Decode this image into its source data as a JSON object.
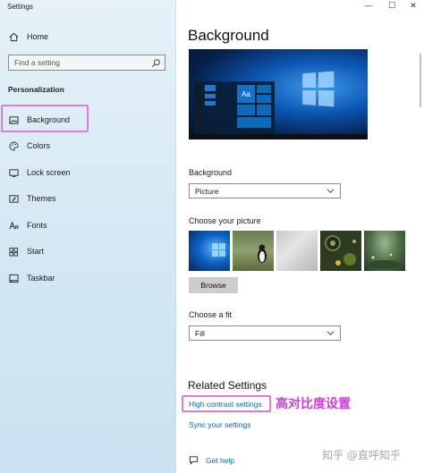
{
  "window": {
    "title": "Settings",
    "controls": [
      "—",
      "☐",
      "✕"
    ]
  },
  "sidebar": {
    "home_label": "Home",
    "search_placeholder": "Find a setting",
    "section_label": "Personalization",
    "items": [
      {
        "label": "Background",
        "icon": "picture-icon",
        "selected": true
      },
      {
        "label": "Colors",
        "icon": "palette-icon"
      },
      {
        "label": "Lock screen",
        "icon": "lock-screen-icon"
      },
      {
        "label": "Themes",
        "icon": "themes-icon"
      },
      {
        "label": "Fonts",
        "icon": "fonts-icon"
      },
      {
        "label": "Start",
        "icon": "start-icon"
      },
      {
        "label": "Taskbar",
        "icon": "taskbar-icon"
      }
    ]
  },
  "main": {
    "title": "Background",
    "preview": {
      "tile_text": "Aa"
    },
    "background": {
      "label": "Background",
      "value": "Picture"
    },
    "picture": {
      "label": "Choose your picture",
      "button_label": "Browse"
    },
    "fit": {
      "label": "Choose a fit",
      "value": "Fill"
    },
    "related": {
      "title": "Related Settings",
      "high_contrast": "High contrast settings",
      "sync": "Sync your settings",
      "annotation": "高对比度设置"
    },
    "help_label": "Get help"
  },
  "watermark": "知乎 @直呼知乎",
  "colors": {
    "accent": "#0067b8",
    "highlight_box": "#e17bd3",
    "annotation": "#c93fd8"
  }
}
